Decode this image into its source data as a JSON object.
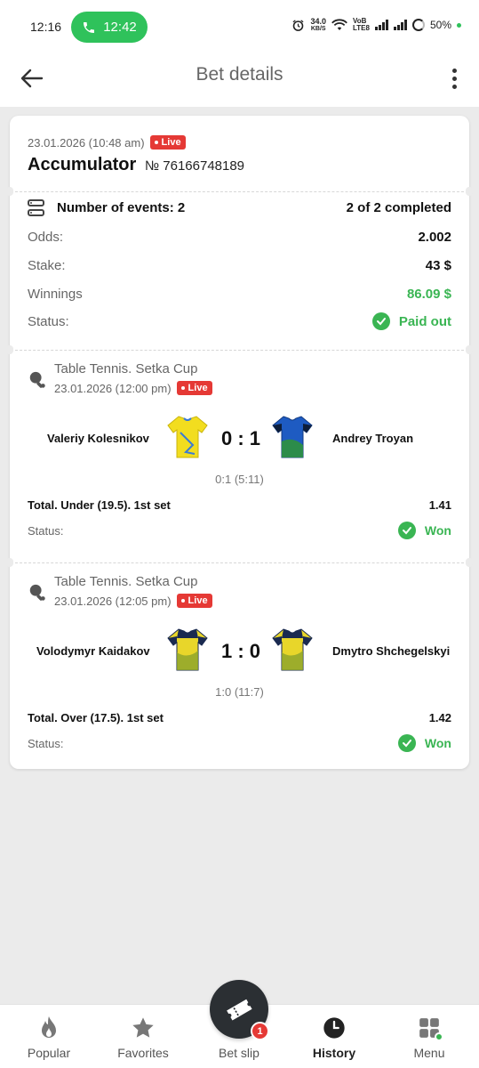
{
  "status_bar": {
    "time": "12:16",
    "call_time": "12:42",
    "net_speed_value": "34.0",
    "net_speed_unit": "KB/S",
    "volte_top": "VoB",
    "volte_bottom": "LTE8",
    "battery": "50%"
  },
  "header": {
    "title": "Bet details"
  },
  "bet": {
    "date": "23.01.2026 (10:48 am)",
    "live_label": "Live",
    "type": "Accumulator",
    "number": "№ 76166748189",
    "events_label": "Number of events: 2",
    "events_completed": "2 of 2 completed",
    "odds_label": "Odds:",
    "odds": "2.002",
    "stake_label": "Stake:",
    "stake": "43 $",
    "winnings_label": "Winnings",
    "winnings": "86.09 $",
    "status_label": "Status:",
    "status": "Paid out"
  },
  "events": [
    {
      "league": "Table Tennis. Setka Cup",
      "date": "23.01.2026 (12:00 pm)",
      "live_label": "Live",
      "home": "Valeriy Kolesnikov",
      "away": "Andrey Troyan",
      "score": "0 : 1",
      "period": "0:1 (5:11)",
      "bet": "Total. Under (19.5). 1st set",
      "odds": "1.41",
      "status_label": "Status:",
      "status": "Won"
    },
    {
      "league": "Table Tennis. Setka Cup",
      "date": "23.01.2026 (12:05 pm)",
      "live_label": "Live",
      "home": "Volodymyr Kaidakov",
      "away": "Dmytro Shchegelskyi",
      "score": "1 : 0",
      "period": "1:0 (11:7)",
      "bet": "Total. Over (17.5). 1st set",
      "odds": "1.42",
      "status_label": "Status:",
      "status": "Won"
    }
  ],
  "nav": {
    "popular": "Popular",
    "favorites": "Favorites",
    "betslip": "Bet slip",
    "betslip_badge": "1",
    "history": "History",
    "menu": "Menu"
  },
  "colors": {
    "accent_green": "#3ab553",
    "live_red": "#e53935",
    "call_green": "#2fc25b"
  }
}
